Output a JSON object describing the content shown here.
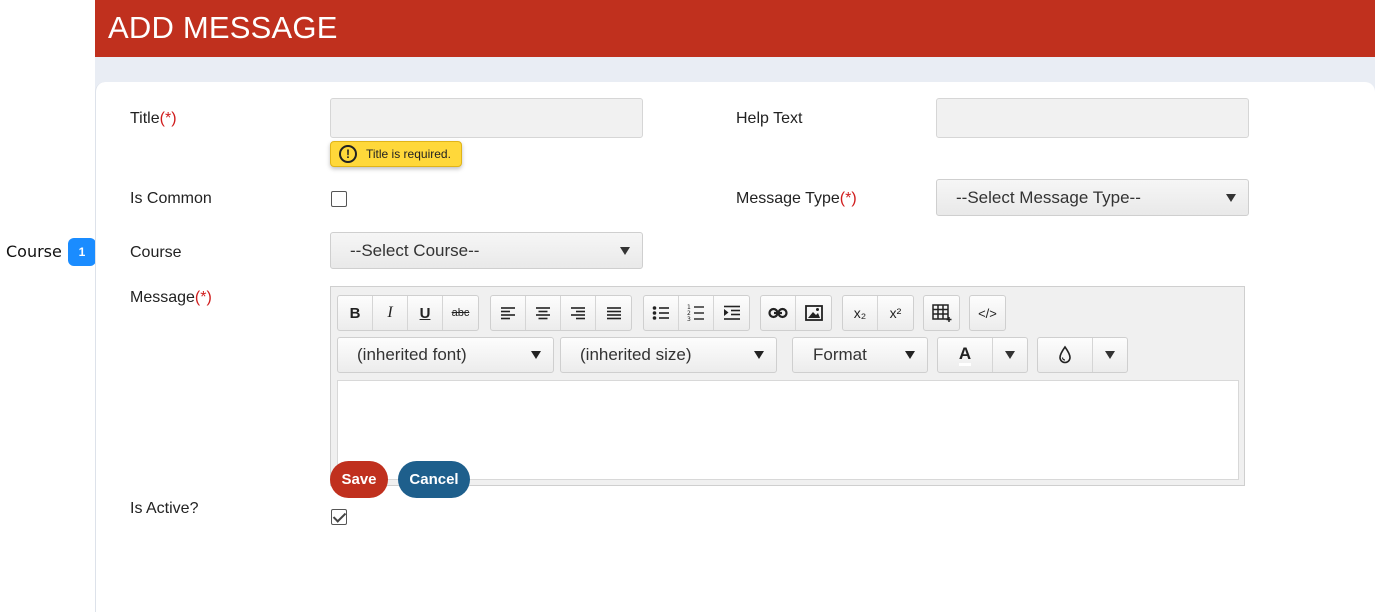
{
  "annotation": {
    "label": "Course",
    "badge": "1"
  },
  "header": {
    "title": "ADD MESSAGE"
  },
  "form": {
    "title_label": "Title",
    "required_mark": "(*)",
    "title_error": "Title is required.",
    "help_text_label": "Help Text",
    "is_common_label": "Is Common",
    "message_type_label": "Message Type",
    "message_type_value": "--Select Message Type--",
    "course_label": "Course",
    "course_value": "--Select Course--",
    "message_label": "Message",
    "is_active_label": "Is Active?",
    "is_common_checked": false,
    "is_active_checked": true
  },
  "editor": {
    "font_value": "(inherited font)",
    "size_value": "(inherited size)",
    "format_value": "Format",
    "buttons": {
      "bold": "B",
      "italic": "I",
      "underline": "U",
      "strike": "abc",
      "subscript": "x₂",
      "superscript": "x²",
      "code": "</>",
      "text_color": "A"
    }
  },
  "actions": {
    "save": "Save",
    "cancel": "Cancel"
  },
  "colors": {
    "header": "#c0301e",
    "save": "#c0301e",
    "cancel": "#1e5f8c",
    "required": "#d01c1c",
    "tooltip": "#ffd83a",
    "annotation": "#1a8cff"
  }
}
